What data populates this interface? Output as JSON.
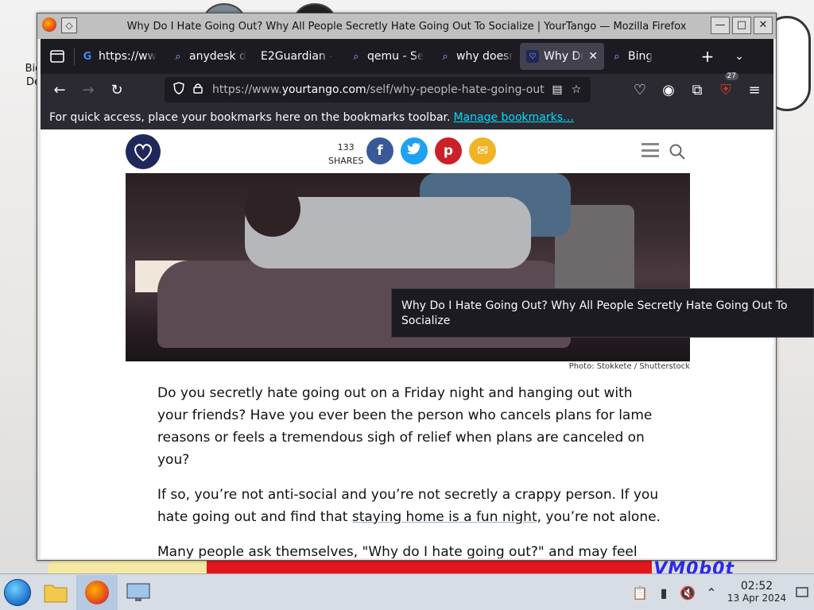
{
  "window": {
    "title": "Why Do I Hate Going Out? Why All People Secretly Hate Going Out To Socialize | YourTango — Mozilla Firefox",
    "minimize_icon": "minimize-icon",
    "maximize_icon": "maximize-icon",
    "close_icon": "close-icon"
  },
  "desktop": {
    "icon_label": "Big\nDe",
    "watermark": "VM0b0t"
  },
  "tabs": [
    {
      "label": "https://ww",
      "icon": "google-icon"
    },
    {
      "label": "anydesk d",
      "icon": "search-icon"
    },
    {
      "label": "E2Guardian -",
      "icon": ""
    },
    {
      "label": "qemu - Se",
      "icon": "search-icon"
    },
    {
      "label": "why doesn",
      "icon": "search-icon"
    },
    {
      "label": "Why Do",
      "icon": "yourtango-icon",
      "active": true
    },
    {
      "label": "Bing",
      "icon": "search-icon"
    }
  ],
  "navbar": {
    "url_prefix": "https://www.",
    "url_domain": "yourtango.com",
    "url_rest": "/self/why-people-hate-going-out",
    "extensions_badge": "27"
  },
  "bookmarks_bar": {
    "message": "For quick access, place your bookmarks here on the bookmarks toolbar.",
    "link": "Manage bookmarks…"
  },
  "site": {
    "shares_count": "133",
    "shares_label": "SHARES",
    "social": [
      {
        "name": "facebook",
        "glyph": "f",
        "color": "#3b5998"
      },
      {
        "name": "twitter",
        "glyph": "t",
        "color": "#1da1f2"
      },
      {
        "name": "pinterest",
        "glyph": "p",
        "color": "#cb2027"
      },
      {
        "name": "email",
        "glyph": "✉",
        "color": "#f0b323"
      }
    ]
  },
  "tooltip": "Why Do I Hate Going Out? Why All People Secretly Hate Going Out To Socialize",
  "photo_credit": "Photo: Stokkete / Shutterstock",
  "article": {
    "p1": "Do you secretly hate going out on a Friday night and hanging out with your friends? Have you ever been the person who cancels plans for lame reasons or feels a tremendous sigh of relief when plans are canceled on you?",
    "p2_before": "If so, you’re not anti-social and you’re not secretly a crappy person. If you hate going out and find that ",
    "p2_link": "staying home is a fun night",
    "p2_after": ", you’re not alone.",
    "p3": "Many people ask themselves, \"Why do I hate going out?\" and may feel"
  },
  "taskbar": {
    "time": "02:52",
    "date": "13 Apr 2024"
  }
}
